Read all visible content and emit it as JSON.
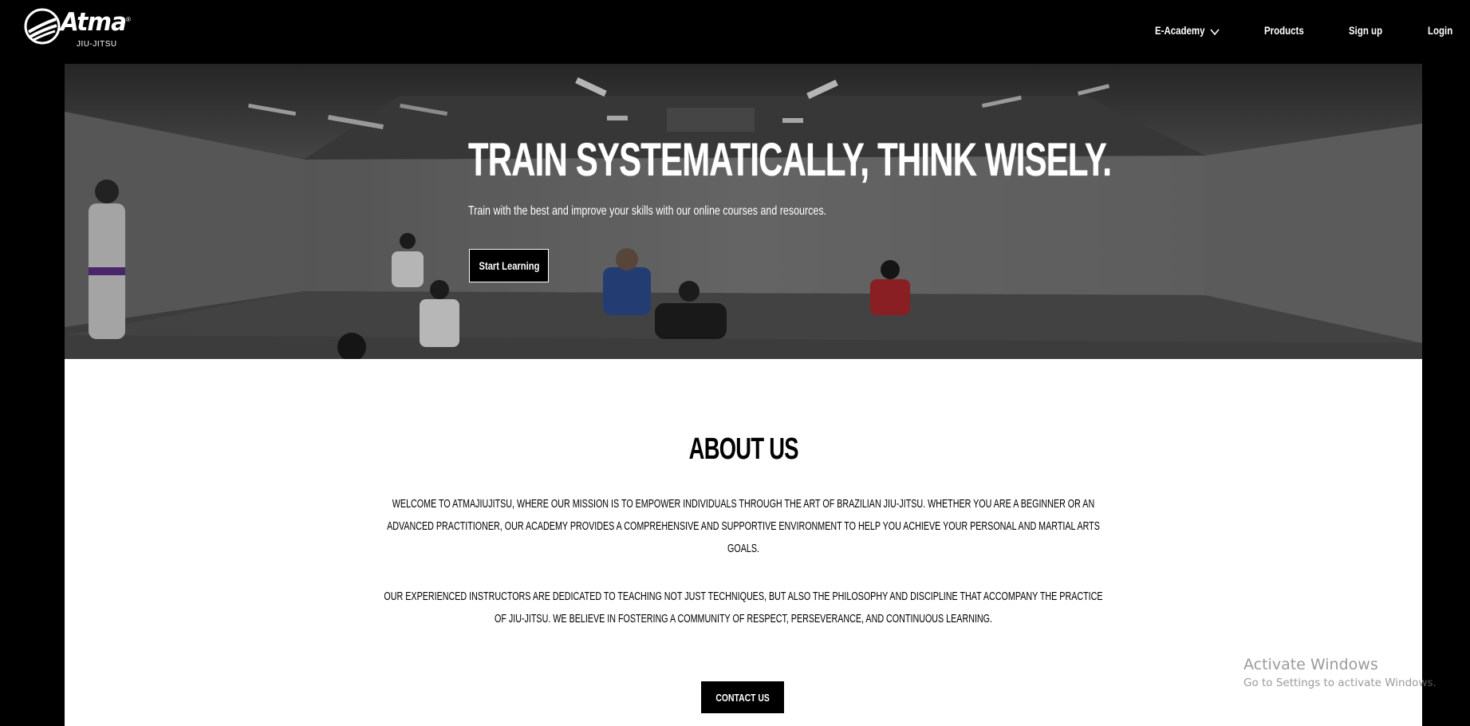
{
  "brand": {
    "name": "Atma",
    "registered_mark": "®",
    "tagline": "JIU-JITSU"
  },
  "nav": {
    "academy_label": "E-Academy",
    "products_label": "Products",
    "signup_label": "Sign up",
    "login_label": "Login",
    "academy_icon": "chevron-down-icon"
  },
  "hero": {
    "title": "TRAIN SYSTEMATICALLY, THINK WISELY.",
    "subtitle": "Train with the best and improve your skills with our online courses and resources.",
    "cta_label": "Start Learning"
  },
  "about": {
    "title": "ABOUT US",
    "paragraph1": "Welcome to AtmaJiuJitsu, where our mission is to empower individuals through the art of Brazilian Jiu-Jitsu. Whether you are a beginner or an advanced practitioner, our academy provides a comprehensive and supportive environment to help you achieve your personal and martial arts goals.",
    "paragraph2": "Our experienced instructors are dedicated to teaching not just techniques, but also the philosophy and discipline that accompany the practice of Jiu-Jitsu. We believe in fostering a community of respect, perseverance, and continuous learning.",
    "contact_label": "CONTACT US"
  },
  "watermark": {
    "line1": "Activate Windows",
    "line2": "Go to Settings to activate Windows."
  },
  "colors": {
    "background": "#000000",
    "section": "#ffffff",
    "accent": "#000000"
  }
}
